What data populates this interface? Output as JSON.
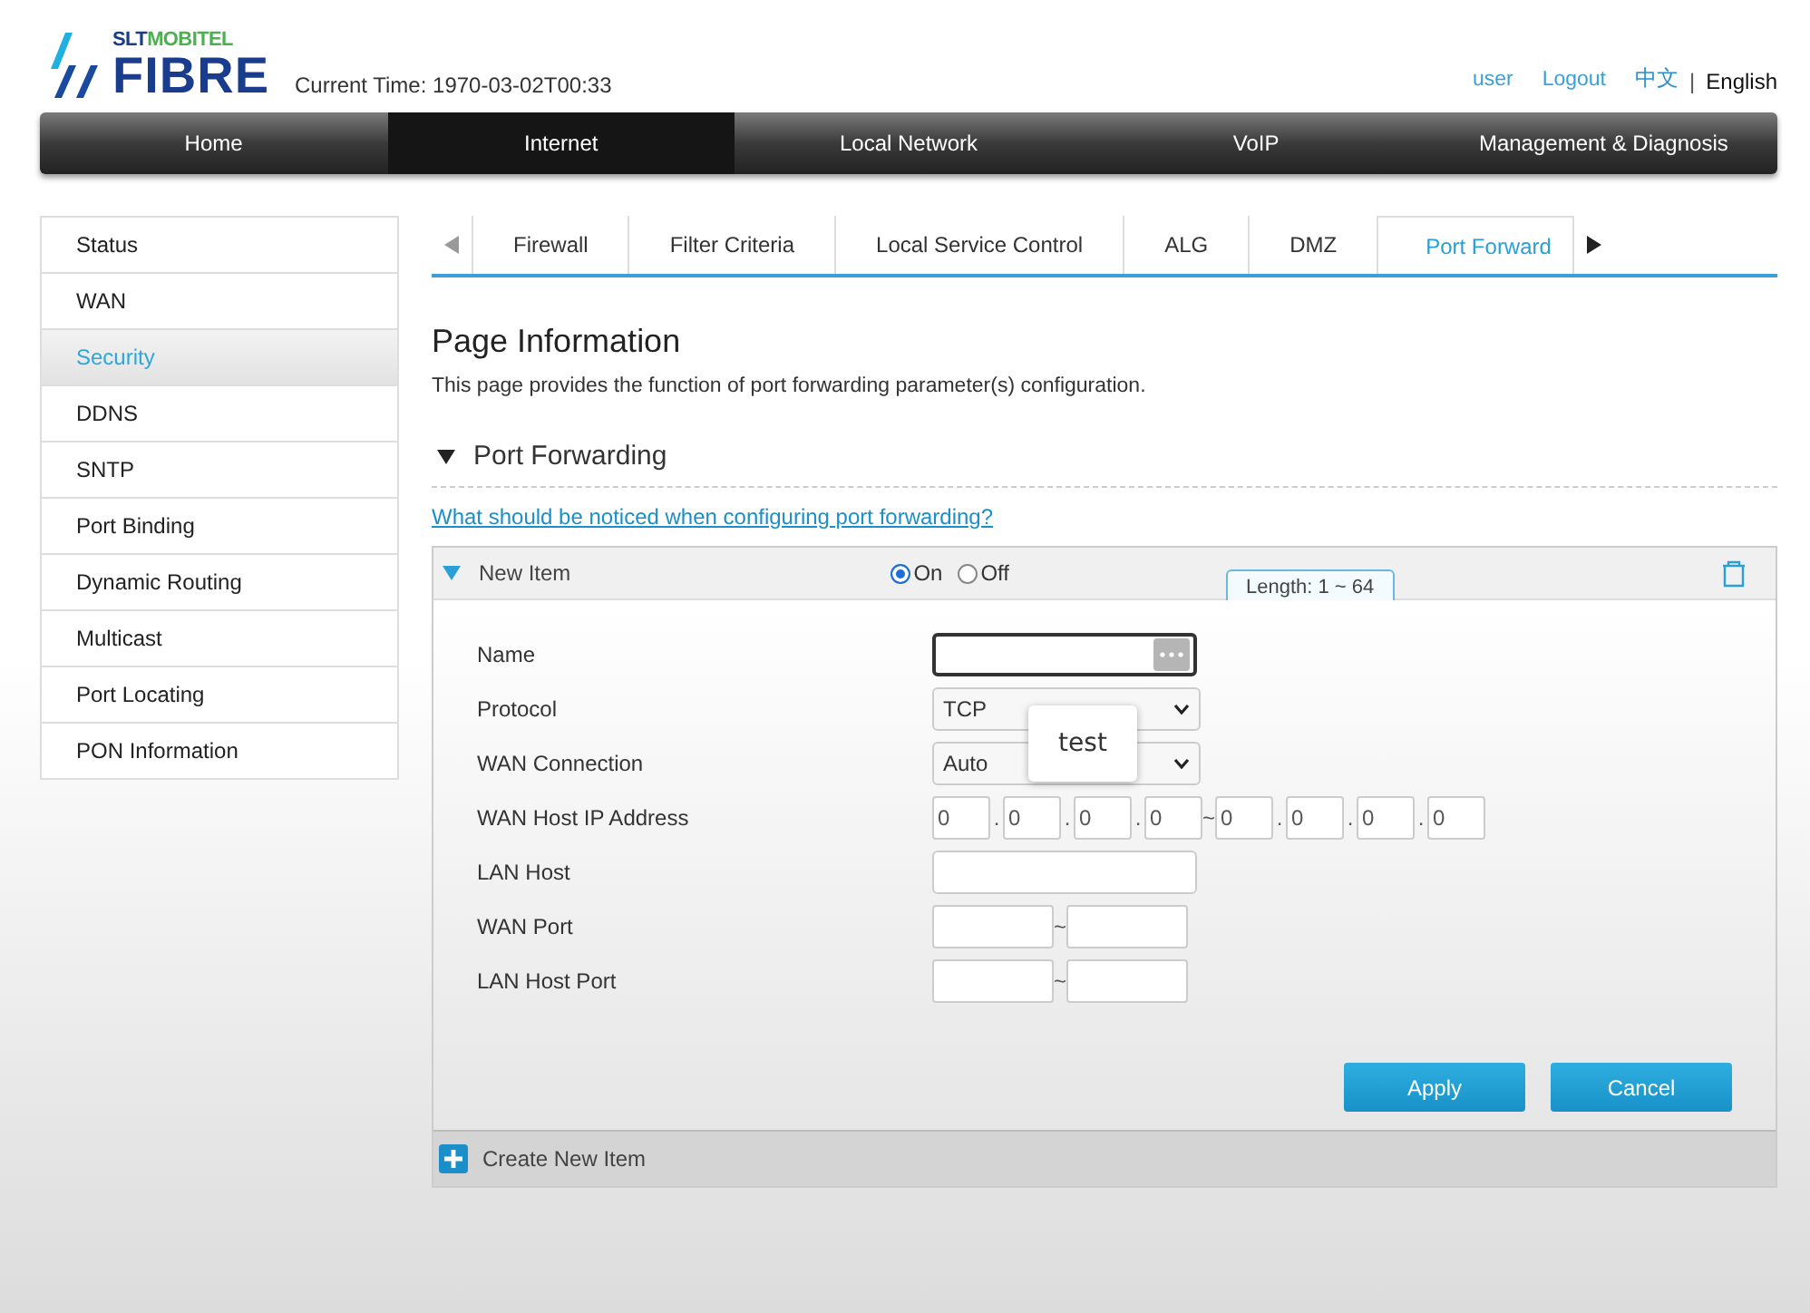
{
  "header": {
    "logo_top": [
      "SLT",
      "MOBITEL"
    ],
    "logo_main": "FIBRE",
    "current_time": "Current Time: 1970-03-02T00:33",
    "user_links": [
      "user",
      "Logout"
    ],
    "languages": [
      {
        "label": "中文",
        "selected": false
      },
      {
        "label": "English",
        "selected": true
      }
    ],
    "language_separator": "|"
  },
  "nav": [
    {
      "label": "Home",
      "selected": false
    },
    {
      "label": "Internet",
      "selected": true
    },
    {
      "label": "Local Network",
      "selected": false
    },
    {
      "label": "VoIP",
      "selected": false
    },
    {
      "label": "Management & Diagnosis",
      "selected": false
    }
  ],
  "sidebar": {
    "items": [
      {
        "label": "Status",
        "selected": false
      },
      {
        "label": "WAN",
        "selected": false
      },
      {
        "label": "Security",
        "selected": true
      },
      {
        "label": "DDNS",
        "selected": false
      },
      {
        "label": "SNTP",
        "selected": false
      },
      {
        "label": "Port Binding",
        "selected": false
      },
      {
        "label": "Dynamic Routing",
        "selected": false
      },
      {
        "label": "Multicast",
        "selected": false
      },
      {
        "label": "Port Locating",
        "selected": false
      },
      {
        "label": "PON Information",
        "selected": false
      }
    ]
  },
  "tabs": [
    {
      "label": "Firewall",
      "selected": false
    },
    {
      "label": "Filter Criteria",
      "selected": false
    },
    {
      "label": "Local Service Control",
      "selected": false
    },
    {
      "label": "ALG",
      "selected": false
    },
    {
      "label": "DMZ",
      "selected": false
    },
    {
      "label": "Port Forward",
      "selected": true
    }
  ],
  "page_info": {
    "title": "Page Information",
    "description": "This page provides the function of port forwarding parameter(s) configuration."
  },
  "section": {
    "title": "Port Forwarding",
    "expanded": true,
    "help_link": "What should be noticed when configuring port forwarding?"
  },
  "item": {
    "title": "New Item",
    "expanded": true,
    "options": [
      {
        "label": "On",
        "selected": true
      },
      {
        "label": "Off",
        "selected": false
      }
    ],
    "tooltip": "Length: 1 ~ 64",
    "autocomplete": "test",
    "ip_separator": ".",
    "range_separator": "~",
    "fields": [
      {
        "kind": "text",
        "label": "Name",
        "focused": true
      },
      {
        "kind": "select",
        "label": "Protocol",
        "value": "TCP"
      },
      {
        "kind": "select",
        "label": "WAN Connection",
        "value": "Auto"
      },
      {
        "kind": "ip",
        "label": "WAN Host IP Address",
        "values": [
          "0",
          "0",
          "0",
          "0",
          "0",
          "0",
          "0",
          "0"
        ]
      },
      {
        "kind": "text",
        "label": "LAN Host",
        "focused": false
      },
      {
        "kind": "range",
        "label": "WAN Port"
      },
      {
        "kind": "range",
        "label": "LAN Host Port"
      }
    ],
    "buttons": [
      "Apply",
      "Cancel"
    ]
  },
  "create_item": "Create New Item"
}
